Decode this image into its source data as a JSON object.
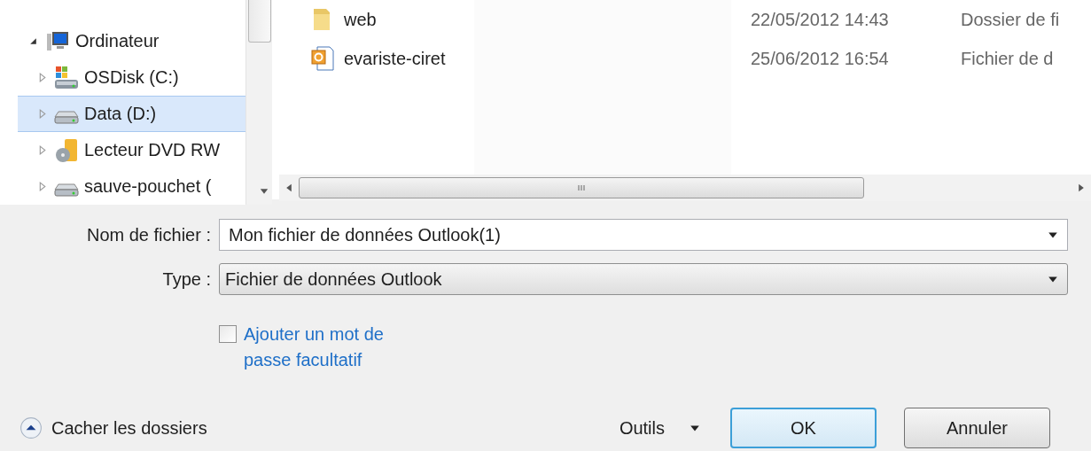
{
  "navigation": {
    "items": [
      {
        "label": "Ordinateur",
        "kind": "computer",
        "expanded": true,
        "selected": false,
        "children": [
          {
            "label": "OSDisk (C:)",
            "kind": "system-drive",
            "expanded": false,
            "selected": false
          },
          {
            "label": "Data (D:)",
            "kind": "drive",
            "expanded": false,
            "selected": true
          },
          {
            "label": "Lecteur DVD RW",
            "kind": "dvd",
            "expanded": false,
            "selected": false
          },
          {
            "label": "sauve-pouchet (",
            "kind": "drive",
            "expanded": false,
            "selected": false
          }
        ]
      }
    ]
  },
  "files": [
    {
      "name": "web",
      "kind": "folder",
      "modified": "22/05/2012 14:43",
      "type": "Dossier de fi"
    },
    {
      "name": "evariste-ciret",
      "kind": "outlook",
      "modified": "25/06/2012 16:54",
      "type": "Fichier de d"
    }
  ],
  "form": {
    "file_name": {
      "label": "Nom de fichier :",
      "value": "Mon fichier de données Outlook(1)"
    },
    "file_type": {
      "label": "Type :",
      "value": "Fichier de données Outlook"
    },
    "password_option": {
      "label": "Ajouter un mot de passe facultatif",
      "checked": false
    }
  },
  "footer": {
    "hide_folders": "Cacher les dossiers",
    "tools": "Outils",
    "buttons": [
      {
        "label": "OK",
        "default": true
      },
      {
        "label": "Annuler",
        "default": false
      }
    ]
  }
}
